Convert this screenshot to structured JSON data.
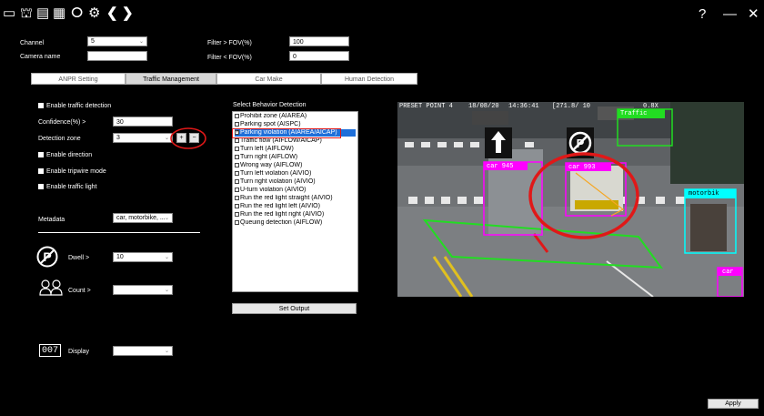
{
  "toolbar": {
    "icons": [
      "window-icon",
      "fisheye-icon",
      "layout-icon",
      "sensor-icon",
      "user-icon",
      "settings-icon",
      "back-icon",
      "forward-icon"
    ],
    "glyphs": {
      "window": "▭",
      "fisheye": "⛫",
      "layout": "▤",
      "sensor": "▦",
      "user": "ⵔ",
      "settings": "⚙",
      "back": "❮",
      "forward": "❯"
    },
    "help_label": "?",
    "minimize_label": "—",
    "close_label": "✕"
  },
  "header_form": {
    "channel_label": "Channel",
    "channel_value": "5",
    "camera_name_label": "Camera name",
    "camera_name_value": "",
    "filter_max_label": "Filter > FOV(%)",
    "filter_max_value": "100",
    "filter_min_label": "Filter < FOV(%)",
    "filter_min_value": "0"
  },
  "tabs": [
    {
      "label": "ANPR Setting",
      "active": false
    },
    {
      "label": "Traffic Management",
      "active": true
    },
    {
      "label": "Car Make",
      "active": false
    },
    {
      "label": "Human Detection",
      "active": false
    }
  ],
  "left_panel": {
    "enable_traffic_detection": "Enable traffic detection",
    "confidence_label": "Confidence(%) >",
    "confidence_value": "30",
    "detection_zone_label": "Detection zone",
    "detection_zone_value": "3",
    "add_label": "+",
    "remove_label": "−",
    "enable_direction": "Enable direction",
    "enable_tripwire": "Enable tripwire mode",
    "enable_traffic_light": "Enable traffic light",
    "metadata_label": "Metadata",
    "metadata_value": "car, motorbike, ...",
    "dwell_label": "Dwell >",
    "dwell_value": "10",
    "count_label": "Count >",
    "count_value": "",
    "display_label": "Display",
    "display_value": "",
    "display_icon_text": "007"
  },
  "behavior": {
    "title": "Select Behavior Detection",
    "items": [
      {
        "label": "Prohibit zone (AIAREA)",
        "checked": false,
        "selected": false
      },
      {
        "label": "Parking spot (AISPC)",
        "checked": false,
        "selected": false
      },
      {
        "label": "Parking violation (AIAREA/AICAP)",
        "checked": true,
        "selected": true
      },
      {
        "label": "Traffic flow (AIFLOW/AICAP)",
        "checked": false,
        "selected": false
      },
      {
        "label": "Turn left (AIFLOW)",
        "checked": false,
        "selected": false
      },
      {
        "label": "Turn right (AIFLOW)",
        "checked": false,
        "selected": false
      },
      {
        "label": "Wrong way (AIFLOW)",
        "checked": false,
        "selected": false
      },
      {
        "label": "Turn left violation (AIVIO)",
        "checked": false,
        "selected": false
      },
      {
        "label": "Turn right violation (AIVIO)",
        "checked": false,
        "selected": false
      },
      {
        "label": "U-turn violation (AIVIO)",
        "checked": false,
        "selected": false
      },
      {
        "label": "Run the red light straight (AIVIO)",
        "checked": false,
        "selected": false
      },
      {
        "label": "Run the red light left (AIVIO)",
        "checked": false,
        "selected": false
      },
      {
        "label": "Run the red light right (AIVIO)",
        "checked": false,
        "selected": false
      },
      {
        "label": "Queuing detection (AIFLOW)",
        "checked": false,
        "selected": false
      }
    ],
    "set_output_label": "Set Output"
  },
  "video": {
    "osd_date": "18/08/20",
    "osd_time": "14:36:41",
    "osd_extra": "[271.8/ 10",
    "osd_zoom": "0.8X",
    "osd_preset": "PRESET POINT",
    "osd_preset_num": "4",
    "labels": {
      "car1": "car 945",
      "car2": "car 993",
      "traffic": "Traffic",
      "motorbike": "motorbik",
      "car3": "car"
    }
  },
  "apply_label": "Apply",
  "colors": {
    "magenta": "#ff00ff",
    "green": "#22dd22",
    "cyan": "#00ffff",
    "annotation_red": "#e01818",
    "selection_blue": "#1e6fd9"
  }
}
